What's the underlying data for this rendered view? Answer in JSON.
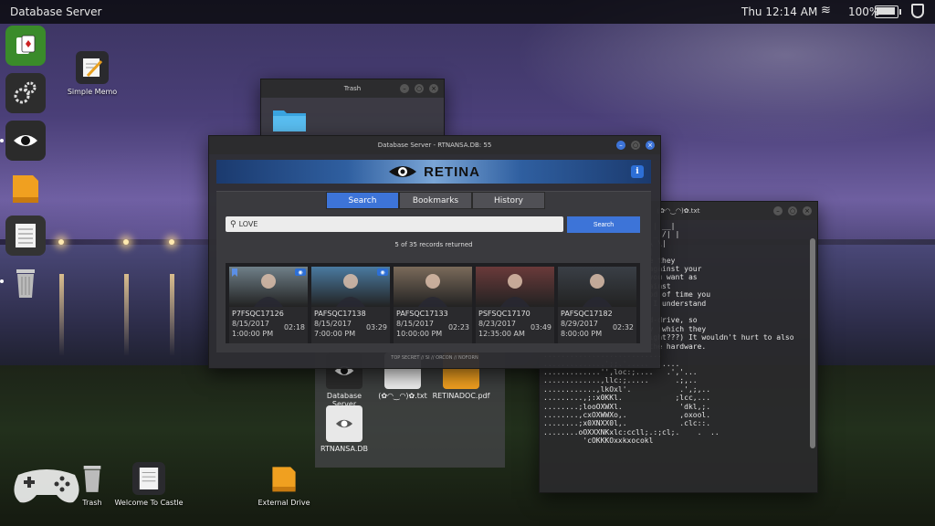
{
  "topbar": {
    "app_title": "Database Server",
    "clock": "Thu 12:14 AM",
    "battery_pct": "100%",
    "battery_level": 1.0
  },
  "dock": {
    "items": [
      "cards-icon",
      "gears-icon",
      "eye-icon",
      "drive-icon",
      "notes-icon",
      "trash-icon"
    ]
  },
  "desktop": {
    "simple_memo": "Simple Memo",
    "trash": "Trash",
    "welcome": "Welcome To Castle",
    "external_drive": "External Drive"
  },
  "trash_window": {
    "title": "Trash"
  },
  "retina_window": {
    "title": "Database Server - RTNANSA.DB: 55",
    "banner_title": "RETINA",
    "info_label": "i",
    "tabs": [
      {
        "label": "Search",
        "active": true
      },
      {
        "label": "Bookmarks",
        "active": false
      },
      {
        "label": "History",
        "active": false
      }
    ],
    "search_value": "LOVE",
    "search_button": "Search",
    "records": "5 of 35 records returned",
    "results": [
      {
        "id": "P7FSQC17126",
        "date": "8/15/2017",
        "time": "1:00:00 PM",
        "duration": "02:18",
        "bookmarked": true,
        "viewed": true,
        "thumb": "#6f7f88"
      },
      {
        "id": "PAFSQC17138",
        "date": "8/15/2017",
        "time": "7:00:00 PM",
        "duration": "03:29",
        "bookmarked": false,
        "viewed": true,
        "thumb": "#4a7aa0"
      },
      {
        "id": "PAFSQC17133",
        "date": "8/15/2017",
        "time": "10:00:00 PM",
        "duration": "02:23",
        "bookmarked": false,
        "viewed": false,
        "thumb": "#7a6a5a"
      },
      {
        "id": "PSFSQC17170",
        "date": "8/23/2017",
        "time": "12:35:00 AM",
        "duration": "03:49",
        "bookmarked": false,
        "viewed": false,
        "thumb": "#6a3a3a"
      },
      {
        "id": "PAFSQC17182",
        "date": "8/29/2017",
        "time": "8:00:00 PM",
        "duration": "02:32",
        "bookmarked": false,
        "viewed": false,
        "thumb": "#3a3f46"
      }
    ],
    "footer": "TOP SECRET // SI // ORCON // NOFORN"
  },
  "terminal": {
    "title": "(✿◠‿◠)✿.txt",
    "lines": [
      "    / /\\ \\ |  _  /  /\\ \\ | __|",
      "   / /\\ \\ \\  | < /  /\\ \\ _ /| |",
      "  \\ \\ | . \\ / ____ \\| | \\ \\|",
      "    \\_\\ |_\\ \\_/_/   \\_\\_|",
      "",
      "    dump of Retina before they",
      "    his is what came up against your",
      "     this is everything you want as",
      "    already partioned against",
      "    ms to cover the period of time you",
      "     of the faces -- NOW I understand",
      "    tuff!",
      "",
      "    t will erase the hard-drive, so",
      "    take you into custody (which they",
      "will -- you know this, right???) It wouldn't hurt to also",
      "burn/dissolve/pulverize the hardware.",
      "",
      "...........................",
      "..............';;.'.....  .....",
      ".............'',loc:;....   .','...",
      ".............,llc:;.....      .;,..",
      "............,lkOxl'.           .',;,..",
      ".........,;:x0KKl.            ;lcc,...",
      "........;looOXWXl.             'dkl,;.",
      "........,cxOXWWXo,.            ,oxool.",
      "........;x0XNXX0l,.            .clc::.",
      "........oOXXXNKxlc:ccll;.:;cl;.    .  ..",
      "         'cOKKKOxxkxocokl"
    ]
  },
  "file_manager": {
    "items": [
      {
        "label": "Database Server"
      },
      {
        "label": "(✿◠‿◠)✿.txt"
      },
      {
        "label": "RETINADOC.pdf"
      },
      {
        "label": "RTNANSA.DB"
      }
    ]
  },
  "colors": {
    "accent": "#3d74d8",
    "banner": "#2f5fa0"
  }
}
